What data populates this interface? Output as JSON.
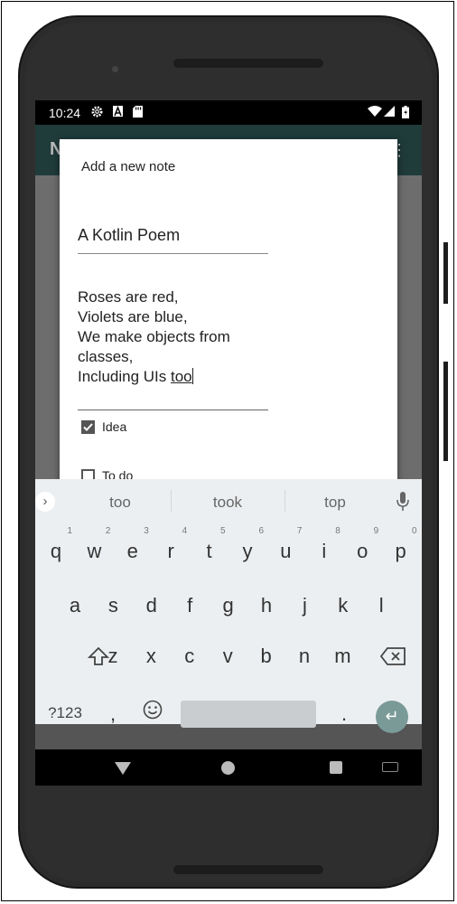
{
  "status": {
    "time": "10:24"
  },
  "dialog": {
    "title": "Add a new note",
    "note_title": "A Kotlin Poem",
    "body_lines": [
      "Roses are red,",
      "Violets are blue,",
      "We make objects from",
      "classes,"
    ],
    "last_line_prefix": "Including UIs ",
    "last_line_word": "too",
    "checkbox_idea": {
      "label": "Idea",
      "checked": true
    },
    "checkbox_todo": {
      "label": "To do",
      "checked": false
    }
  },
  "keyboard": {
    "suggestions": [
      "too",
      "took",
      "top"
    ],
    "row1": [
      "q",
      "w",
      "e",
      "r",
      "t",
      "y",
      "u",
      "i",
      "o",
      "p"
    ],
    "row1_hints": [
      "1",
      "2",
      "3",
      "4",
      "5",
      "6",
      "7",
      "8",
      "9",
      "0"
    ],
    "row2": [
      "a",
      "s",
      "d",
      "f",
      "g",
      "h",
      "j",
      "k",
      "l"
    ],
    "row3": [
      "z",
      "x",
      "c",
      "v",
      "b",
      "n",
      "m"
    ],
    "sym_label": "?123",
    "comma": ",",
    "period": "."
  },
  "icons": {
    "status": [
      "gear-icon",
      "a-icon",
      "sd-card-icon",
      "wifi-icon",
      "signal-icon",
      "battery-icon"
    ],
    "keyboard": [
      "chevron-right-icon",
      "microphone-icon",
      "shift-icon",
      "backspace-icon",
      "emoji-icon",
      "enter-icon"
    ],
    "nav": [
      "back-icon",
      "home-icon",
      "recents-icon",
      "keyboard-switch-icon"
    ]
  },
  "colors": {
    "app_bar": "#1f3b3a",
    "enter_key": "#7a9a98",
    "keyboard_bg": "#eceff1"
  }
}
